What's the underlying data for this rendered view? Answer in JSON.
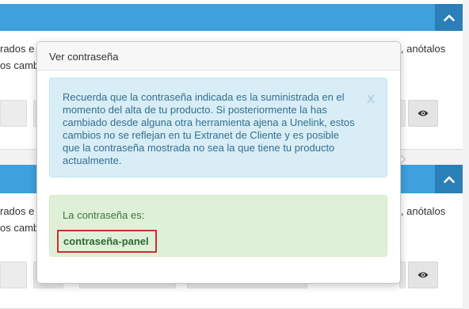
{
  "background": {
    "line_1": "rados e",
    "line_1_right": "l, anótalos",
    "line_2": "os camb",
    "line_3": "rados e",
    "line_3_right": "l, anótalos",
    "line_4": "os camb"
  },
  "popover": {
    "title": "Ver contraseña",
    "info_message": "Recuerda que la contraseña indicada es la suministrada en el momento del alta de tu producto. Si posteriormente la has cambiado desde alguna otra herramienta ajena a Unelink, estos cambios no se reflejan en tu Extranet de Cliente y es posible que la contraseña mostrada no sea la que tiene tu producto actualmente.",
    "close_label": "X",
    "password_label": "La contraseña es:",
    "password_value": "contraseña-panel"
  },
  "colors": {
    "panel_header": "#3ea0dc",
    "collapse_button": "#2b7fb8",
    "info_bg": "#d9edf7",
    "success_bg": "#dff0d8",
    "highlight_border": "#c9302c"
  },
  "icons": {
    "collapse": "chevron-up-icon",
    "view_password": "eye-icon"
  }
}
